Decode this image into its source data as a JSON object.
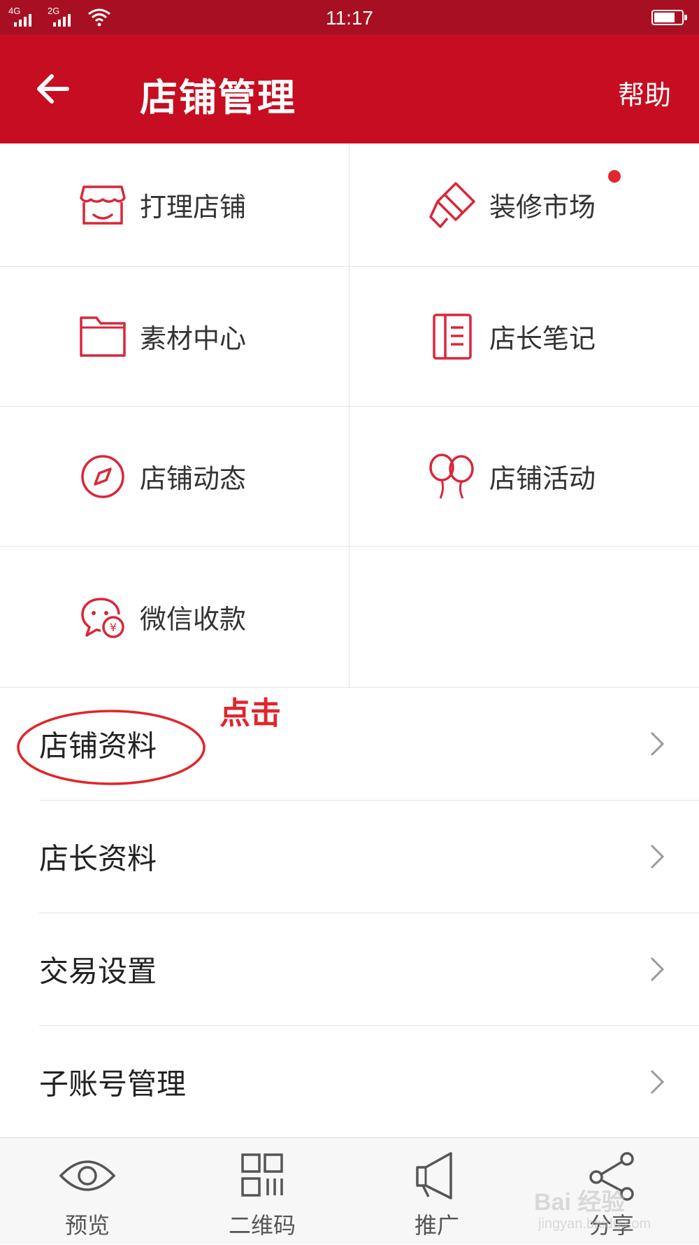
{
  "status_bar": {
    "network_1": "4G",
    "network_2": "2G",
    "time": "11:17",
    "battery_level": 0.75,
    "wifi_icon": "wifi-icon"
  },
  "header": {
    "back_icon": "arrow-left-icon",
    "title": "店铺管理",
    "help_label": "帮助",
    "background_color": "#c70d21"
  },
  "grid": [
    {
      "label": "打理店铺",
      "icon": "storefront-icon"
    },
    {
      "label": "装修市场",
      "icon": "paint-brush-icon",
      "has_badge": true
    },
    {
      "label": "素材中心",
      "icon": "folder-icon"
    },
    {
      "label": "店长笔记",
      "icon": "notebook-icon"
    },
    {
      "label": "店铺动态",
      "icon": "compass-icon"
    },
    {
      "label": "店铺活动",
      "icon": "balloons-icon"
    },
    {
      "label": "微信收款",
      "icon": "wechat-pay-icon"
    }
  ],
  "list": [
    {
      "label": "店铺资料"
    },
    {
      "label": "店长资料"
    },
    {
      "label": "交易设置"
    },
    {
      "label": "子账号管理"
    }
  ],
  "annotation": {
    "text": "点击",
    "color": "#e0252b"
  },
  "bottom_tabs": [
    {
      "label": "预览",
      "icon": "eye-icon"
    },
    {
      "label": "二维码",
      "icon": "qr-code-icon"
    },
    {
      "label": "推广",
      "icon": "megaphone-icon"
    },
    {
      "label": "分享",
      "icon": "share-icon"
    }
  ],
  "watermark": {
    "logo": "Bai 经验",
    "url": "jingyan.baidu.com"
  },
  "colors": {
    "accent": "#c70d21",
    "icon_red": "#d8273a",
    "badge": "#e0282e"
  }
}
